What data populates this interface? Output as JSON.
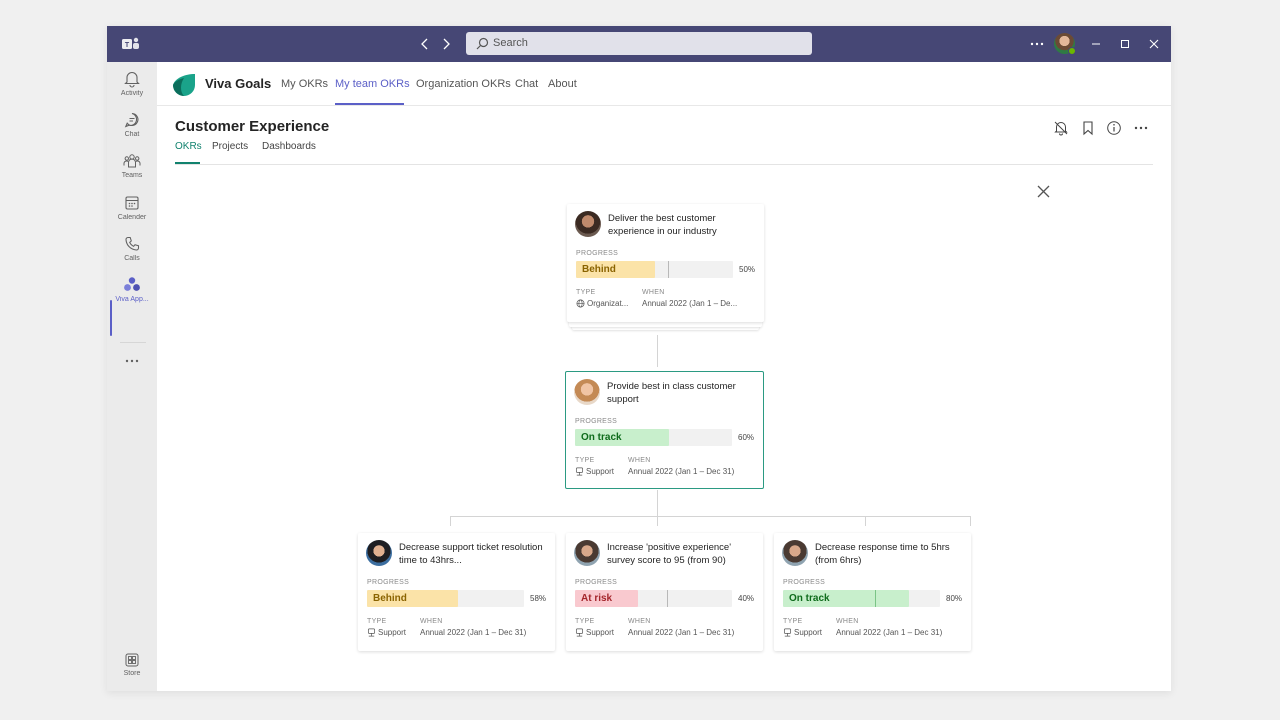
{
  "titlebar": {
    "search_placeholder": "Search"
  },
  "rail": {
    "items": [
      {
        "label": "Activity",
        "icon": "bell-icon"
      },
      {
        "label": "Chat",
        "icon": "chat-icon"
      },
      {
        "label": "Teams",
        "icon": "teams-icon"
      },
      {
        "label": "Calender",
        "icon": "calendar-icon"
      },
      {
        "label": "Calls",
        "icon": "phone-icon"
      },
      {
        "label": "Viva App...",
        "icon": "viva-icon"
      }
    ],
    "store_label": "Store"
  },
  "app": {
    "name": "Viva Goals",
    "tabs": [
      "My OKRs",
      "My team OKRs",
      "Organization OKRs",
      "Chat",
      "About"
    ],
    "active_tab": "My team OKRs"
  },
  "page": {
    "title": "Customer Experience",
    "subtabs": [
      "OKRs",
      "Projects",
      "Dashboards"
    ],
    "active_subtab": "OKRs"
  },
  "labels": {
    "progress": "PROGRESS",
    "type": "TYPE",
    "when": "WHEN"
  },
  "okrs": {
    "top": {
      "title": "Deliver the best customer experience in our industry",
      "status": "Behind",
      "progress": 50,
      "progress_text": "50%",
      "type": "Organizat...",
      "when": "Annual 2022 (Jan 1 – De..."
    },
    "middle": {
      "title": "Provide best in class customer support",
      "status": "On track",
      "progress": 60,
      "progress_text": "60%",
      "type": "Support",
      "when": "Annual 2022 (Jan 1 – Dec 31)"
    },
    "children": [
      {
        "title": "Decrease support ticket resolution time to 43hrs...",
        "status": "Behind",
        "progress": 58,
        "progress_text": "58%",
        "type": "Support",
        "when": "Annual 2022 (Jan 1 – Dec 31)"
      },
      {
        "title": "Increase 'positive experience' survey score to 95 (from 90)",
        "status": "At risk",
        "progress": 40,
        "progress_text": "40%",
        "type": "Support",
        "when": "Annual 2022 (Jan 1 – Dec 31)"
      },
      {
        "title": "Decrease response time to 5hrs (from 6hrs)",
        "status": "On track",
        "progress": 80,
        "progress_text": "80%",
        "type": "Support",
        "when": "Annual 2022 (Jan 1 – Dec 31)"
      }
    ]
  },
  "colors": {
    "teams_purple": "#464775",
    "accent": "#5b5fc7",
    "goals_teal": "#11826e",
    "behind": "#fbe3a8",
    "on_track": "#c8efcc",
    "at_risk": "#f9c9cf"
  }
}
